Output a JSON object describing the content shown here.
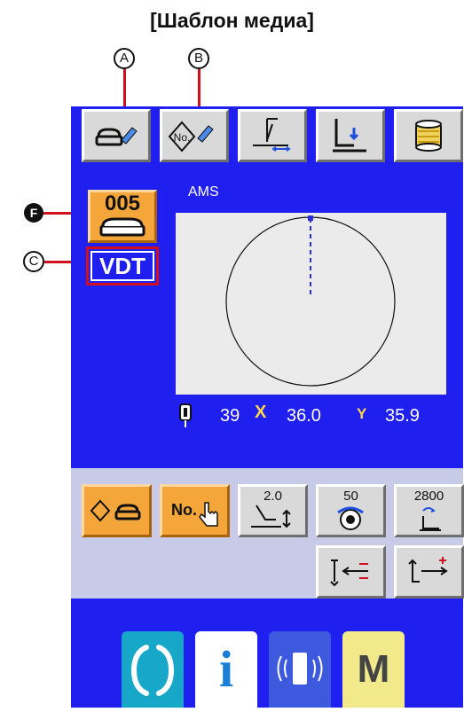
{
  "page": {
    "title": "[Шаблон медиа]"
  },
  "callouts": {
    "a": "A",
    "b": "B",
    "c": "C",
    "f": "F"
  },
  "toolbar": {
    "buttons": [
      {
        "name": "media-edit",
        "icon": "media-edit-icon"
      },
      {
        "name": "number-edit",
        "icon": "number-edit-icon",
        "label": "No."
      },
      {
        "name": "thread-tension",
        "icon": "thread-tension-icon"
      },
      {
        "name": "presser-foot",
        "icon": "presser-foot-icon"
      },
      {
        "name": "bobbin",
        "icon": "bobbin-icon"
      }
    ]
  },
  "pattern": {
    "number": "005",
    "type": "VDT",
    "model": "AMS"
  },
  "readout": {
    "stitch_count": "39",
    "x_label": "X",
    "x_value": "36.0",
    "y_label": "Y",
    "y_value": "35.9"
  },
  "bottom_buttons": {
    "media_select": {
      "icon": "media-select-icon"
    },
    "number_select": {
      "label": "No.",
      "icon": "hand-pointer-icon"
    },
    "stitch_length": {
      "value": "2.0"
    },
    "speed_pct": {
      "value": "50"
    },
    "max_speed": {
      "value": "2800"
    }
  },
  "footer": {
    "ready": {
      "icon": "ready-icon"
    },
    "info": {
      "label": "i"
    },
    "communication": {
      "icon": "communication-icon"
    },
    "mode": {
      "label": "M"
    }
  },
  "colors": {
    "screen_blue": "#1f1ff0",
    "orange": "#f4a63a",
    "callout_red": "#d0101e",
    "panel": "#c7cbe8",
    "ready_cyan": "#16a7c9",
    "mode_yellow": "#f1e98a"
  }
}
